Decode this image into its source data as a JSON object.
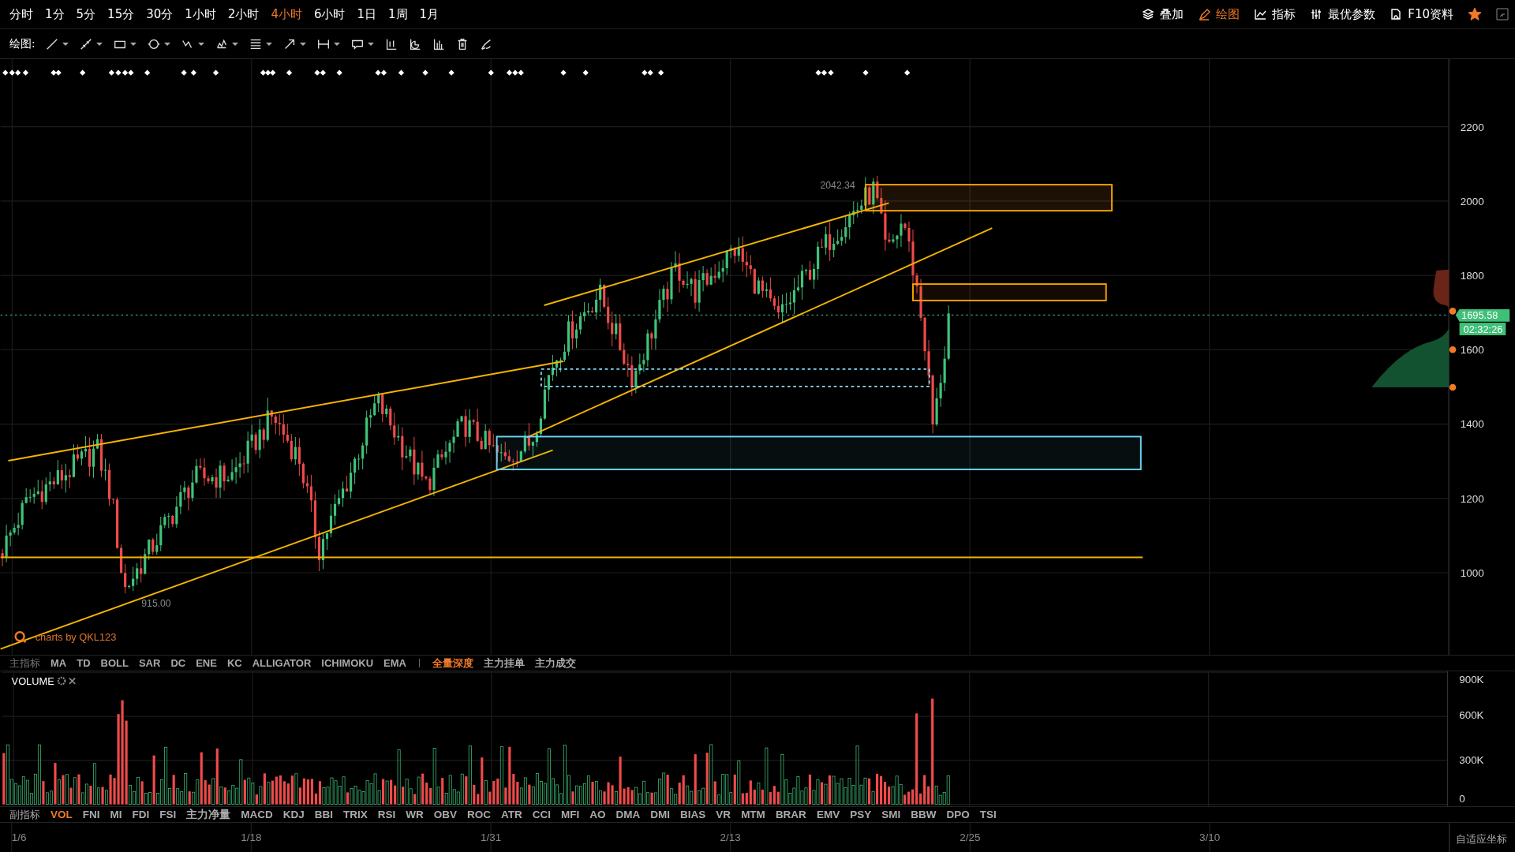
{
  "timeframes": [
    {
      "label": "分时",
      "selected": false
    },
    {
      "label": "1分",
      "selected": false
    },
    {
      "label": "5分",
      "selected": false
    },
    {
      "label": "15分",
      "selected": false
    },
    {
      "label": "30分",
      "selected": false
    },
    {
      "label": "1小时",
      "selected": false
    },
    {
      "label": "2小时",
      "selected": false
    },
    {
      "label": "4小时",
      "selected": true
    },
    {
      "label": "6小时",
      "selected": false
    },
    {
      "label": "1日",
      "selected": false
    },
    {
      "label": "1周",
      "selected": false
    },
    {
      "label": "1月",
      "selected": false
    }
  ],
  "top_actions": [
    {
      "kind": "layers",
      "label": "叠加",
      "selected": false
    },
    {
      "kind": "pen",
      "label": "绘图",
      "selected": true
    },
    {
      "kind": "chart",
      "label": "指标",
      "selected": false
    },
    {
      "kind": "sliders",
      "label": "最优参数",
      "selected": false
    },
    {
      "kind": "doc",
      "label": "F10资料",
      "selected": false
    }
  ],
  "favorite": {
    "on": true
  },
  "drawing_toolbar": {
    "label": "绘图:",
    "tools": [
      {
        "kind": "line",
        "dropdown": true
      },
      {
        "kind": "ray",
        "dropdown": true
      },
      {
        "kind": "rect",
        "dropdown": true
      },
      {
        "kind": "circle",
        "dropdown": true
      },
      {
        "kind": "wave",
        "dropdown": true
      },
      {
        "kind": "pattern",
        "dropdown": true
      },
      {
        "kind": "fib",
        "dropdown": true
      },
      {
        "kind": "arrow",
        "dropdown": true
      },
      {
        "kind": "measure",
        "dropdown": true
      },
      {
        "kind": "note",
        "dropdown": true
      },
      {
        "kind": "candle",
        "dropdown": false
      },
      {
        "kind": "pie",
        "dropdown": false
      },
      {
        "kind": "bars",
        "dropdown": false
      },
      {
        "kind": "trash",
        "dropdown": false
      },
      {
        "kind": "brush",
        "dropdown": false
      }
    ]
  },
  "price_axis": {
    "ticks": [
      "2200",
      "2000",
      "1800",
      "1600",
      "1400",
      "1200",
      "1000"
    ],
    "current_price": "1695.58",
    "countdown": "02:32:26"
  },
  "annotations": {
    "high": "2042.34",
    "low": "915.00",
    "credit": "charts by QKL123"
  },
  "main_indicators": {
    "label": "主指标",
    "items": [
      {
        "label": "MA",
        "selected": false
      },
      {
        "label": "TD",
        "selected": false
      },
      {
        "label": "BOLL",
        "selected": false
      },
      {
        "label": "SAR",
        "selected": false
      },
      {
        "label": "DC",
        "selected": false
      },
      {
        "label": "ENE",
        "selected": false
      },
      {
        "label": "KC",
        "selected": false
      },
      {
        "label": "ALLIGATOR",
        "selected": false
      },
      {
        "label": "ICHIMOKU",
        "selected": false
      },
      {
        "label": "EMA",
        "selected": false
      }
    ],
    "depth_items": [
      {
        "label": "全量深度",
        "selected": true
      },
      {
        "label": "主力挂单",
        "selected": false
      },
      {
        "label": "主力成交",
        "selected": false
      }
    ]
  },
  "volume": {
    "title": "VOLUME",
    "ticks": [
      "900K",
      "600K",
      "300K",
      "0"
    ]
  },
  "sub_indicators": {
    "label": "副指标",
    "items": [
      {
        "label": "VOL",
        "selected": true
      },
      {
        "label": "FNI",
        "selected": false
      },
      {
        "label": "MI",
        "selected": false
      },
      {
        "label": "FDI",
        "selected": false
      },
      {
        "label": "FSI",
        "selected": false
      },
      {
        "label": "主力净量",
        "selected": false
      },
      {
        "label": "MACD",
        "selected": false
      },
      {
        "label": "KDJ",
        "selected": false
      },
      {
        "label": "BBI",
        "selected": false
      },
      {
        "label": "TRIX",
        "selected": false
      },
      {
        "label": "RSI",
        "selected": false
      },
      {
        "label": "WR",
        "selected": false
      },
      {
        "label": "OBV",
        "selected": false
      },
      {
        "label": "ROC",
        "selected": false
      },
      {
        "label": "ATR",
        "selected": false
      },
      {
        "label": "CCI",
        "selected": false
      },
      {
        "label": "MFI",
        "selected": false
      },
      {
        "label": "AO",
        "selected": false
      },
      {
        "label": "DMA",
        "selected": false
      },
      {
        "label": "DMI",
        "selected": false
      },
      {
        "label": "BIAS",
        "selected": false
      },
      {
        "label": "VR",
        "selected": false
      },
      {
        "label": "MTM",
        "selected": false
      },
      {
        "label": "BRAR",
        "selected": false
      },
      {
        "label": "EMV",
        "selected": false
      },
      {
        "label": "PSY",
        "selected": false
      },
      {
        "label": "SMI",
        "selected": false
      },
      {
        "label": "BBW",
        "selected": false
      },
      {
        "label": "DPO",
        "selected": false
      },
      {
        "label": "TSI",
        "selected": false
      }
    ]
  },
  "dates": [
    "1/6",
    "1/18",
    "1/31",
    "2/13",
    "2/25",
    "3/10"
  ],
  "axis_mode": "自适应坐标"
}
